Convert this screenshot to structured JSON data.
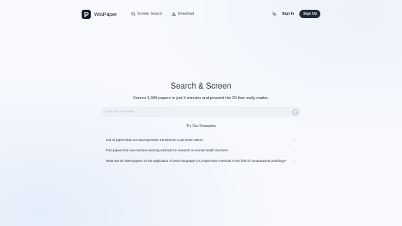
{
  "header": {
    "logo_text": "WisPaper",
    "nav": [
      {
        "label": "Scholar Search",
        "icon": "search-icon"
      },
      {
        "label": "Download",
        "icon": "download-icon"
      }
    ],
    "translate_icon": "translate-icon",
    "sign_in": "Sign In",
    "sign_up": "Sign Up"
  },
  "hero": {
    "title": "Search & Screen",
    "subtitle": "Screen 1,000 papers in just 5 minutes and pinpoint the 20 that really matter."
  },
  "search": {
    "placeholder": "Type your message",
    "value": "",
    "send_icon": "arrow-up-icon"
  },
  "examples": {
    "title": "Try Our Examples",
    "items": [
      {
        "text": "List all papers that use autoregressive transformer to generate videos."
      },
      {
        "text": "Find papers that use machine learning methods for research on mental health disorders."
      },
      {
        "text": "What are the latest papers on the application of vision-language (VL) supervision methods in the field of computational pathology?"
      }
    ]
  },
  "colors": {
    "primary_dark": "#1f2937",
    "background": "#f7f9fc",
    "input_bg": "#eef2f7"
  }
}
